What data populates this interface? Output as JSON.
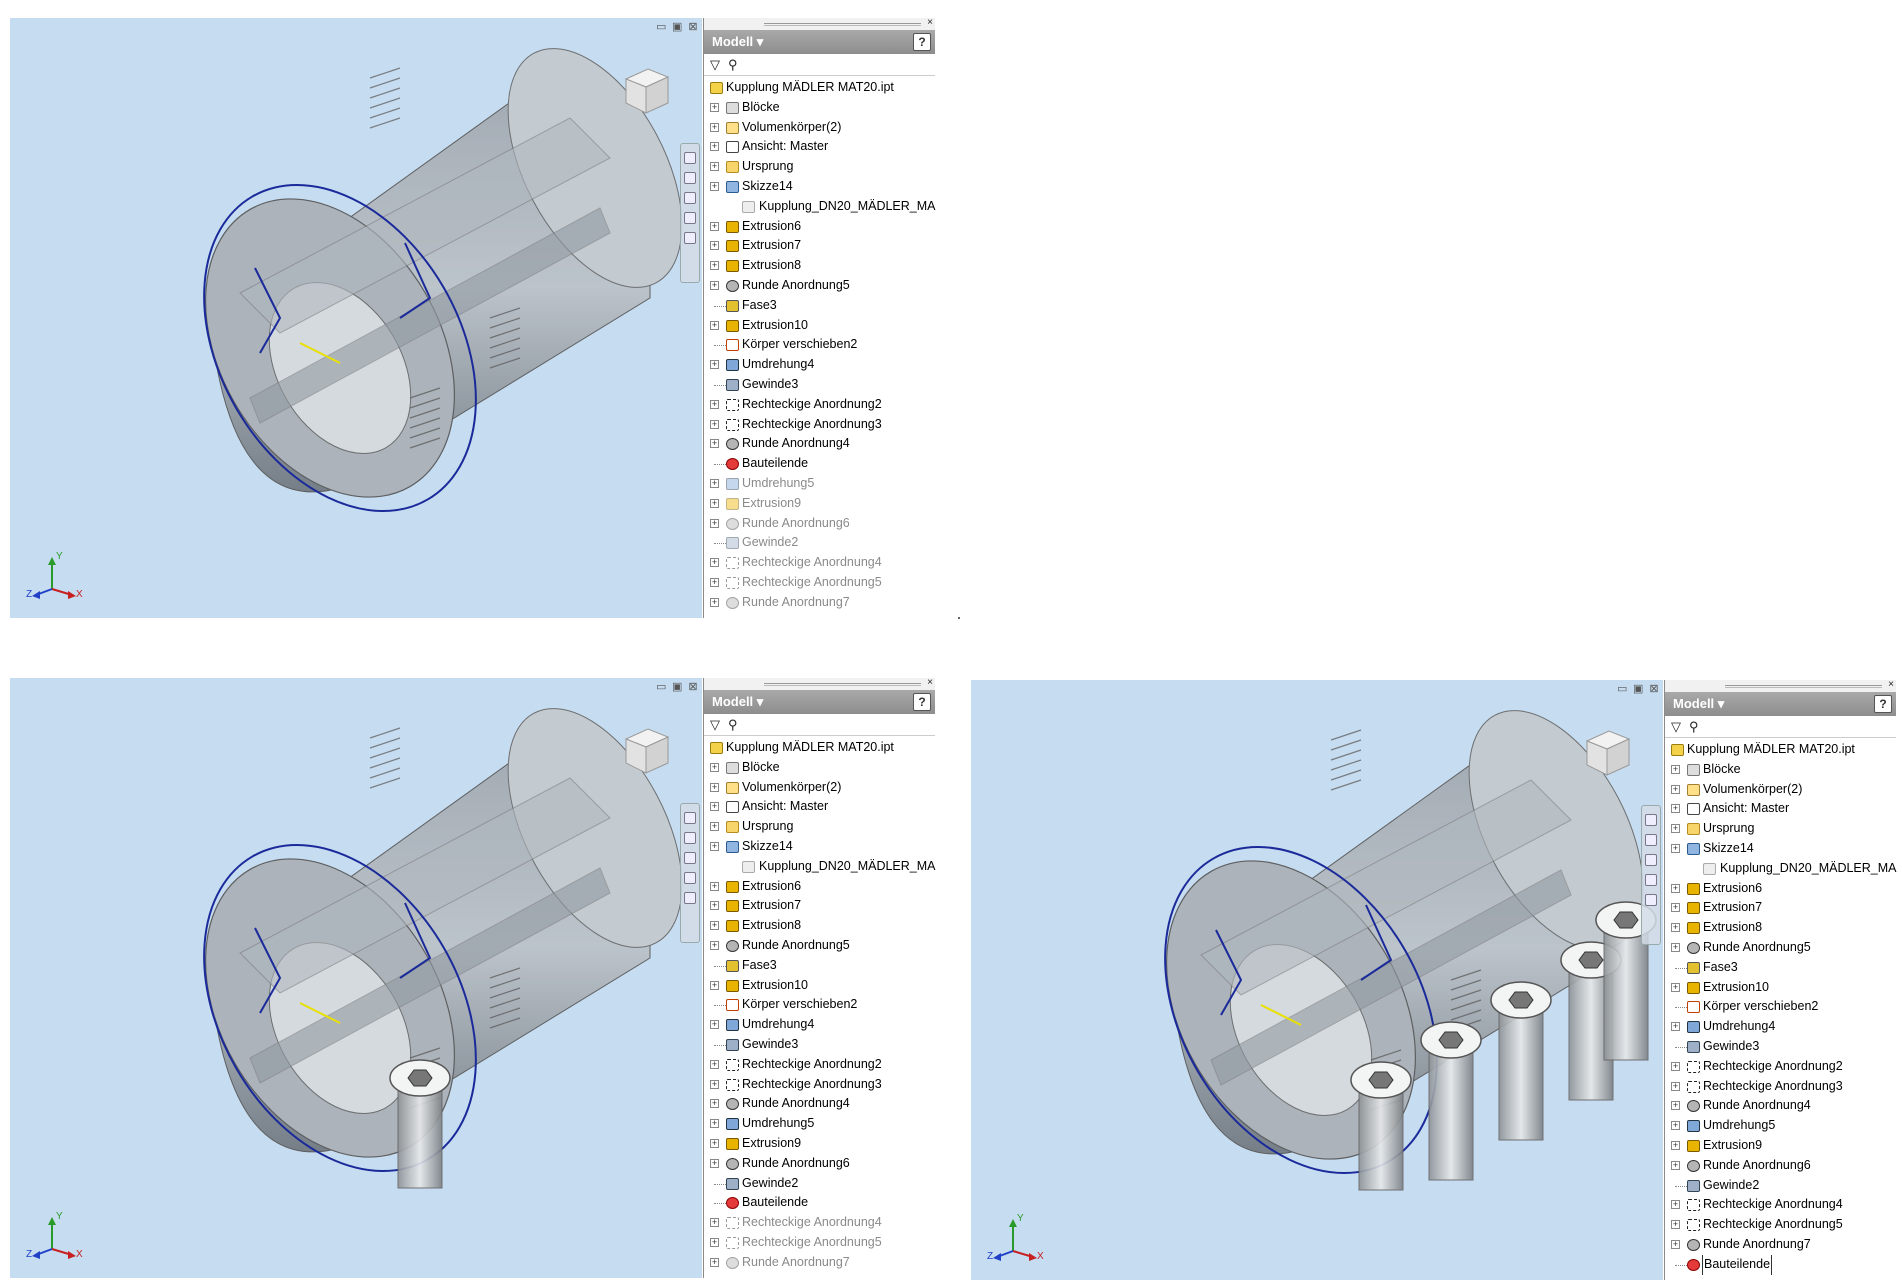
{
  "window_controls": {
    "minimize": "▭",
    "restore": "▣",
    "close": "⊠"
  },
  "browser_labels": {
    "title": "Modell ▾",
    "help": "?",
    "filter_icon": "filter-icon",
    "search_icon": "binoculars-icon",
    "close": "×"
  },
  "triad_labels": {
    "x": "X",
    "y": "Y",
    "z": "Z"
  },
  "panels": [
    {
      "id": "top-left",
      "screws": 0,
      "tree": [
        {
          "label": "Kupplung MÄDLER MAT20.ipt",
          "icon": "part-icon",
          "level": 0
        },
        {
          "label": "Blöcke",
          "icon": "block-icon",
          "level": 1,
          "expander": true
        },
        {
          "label": "Volumenkörper(2)",
          "icon": "solid-bodies-icon",
          "level": 1,
          "expander": true
        },
        {
          "label": "Ansicht: Master",
          "icon": "view-icon",
          "level": 1,
          "expander": true
        },
        {
          "label": "Ursprung",
          "icon": "folder-icon",
          "level": 1,
          "expander": true
        },
        {
          "label": "Skizze14",
          "icon": "sketch-icon",
          "level": 1,
          "expander": true
        },
        {
          "label": "Kupplung_DN20_MÄDLER_MA",
          "icon": "sketch-ref-icon",
          "level": 2
        },
        {
          "label": "Extrusion6",
          "icon": "extrusion-icon",
          "level": 1,
          "expander": true
        },
        {
          "label": "Extrusion7",
          "icon": "extrusion-icon",
          "level": 1,
          "expander": true
        },
        {
          "label": "Extrusion8",
          "icon": "extrusion-icon",
          "level": 1,
          "expander": true
        },
        {
          "label": "Runde Anordnung5",
          "icon": "circular-pattern-icon",
          "level": 1,
          "expander": true
        },
        {
          "label": "Fase3",
          "icon": "chamfer-icon",
          "level": 1
        },
        {
          "label": "Extrusion10",
          "icon": "extrusion-icon",
          "level": 1,
          "expander": true
        },
        {
          "label": "Körper verschieben2",
          "icon": "move-body-icon",
          "level": 1
        },
        {
          "label": "Umdrehung4",
          "icon": "revolve-icon",
          "level": 1,
          "expander": true
        },
        {
          "label": "Gewinde3",
          "icon": "thread-icon",
          "level": 1
        },
        {
          "label": "Rechteckige Anordnung2",
          "icon": "rect-pattern-icon",
          "level": 1,
          "expander": true
        },
        {
          "label": "Rechteckige Anordnung3",
          "icon": "rect-pattern-icon",
          "level": 1,
          "expander": true
        },
        {
          "label": "Runde Anordnung4",
          "icon": "circular-pattern-icon",
          "level": 1,
          "expander": true
        },
        {
          "label": "Bauteilende",
          "icon": "end-of-part-icon",
          "level": 1
        },
        {
          "label": "Umdrehung5",
          "icon": "revolve-icon",
          "level": 1,
          "expander": true,
          "dim": true
        },
        {
          "label": "Extrusion9",
          "icon": "extrusion-icon",
          "level": 1,
          "expander": true,
          "dim": true
        },
        {
          "label": "Runde Anordnung6",
          "icon": "circular-pattern-icon",
          "level": 1,
          "expander": true,
          "dim": true
        },
        {
          "label": "Gewinde2",
          "icon": "thread-icon",
          "level": 1,
          "dim": true
        },
        {
          "label": "Rechteckige Anordnung4",
          "icon": "rect-pattern-icon",
          "level": 1,
          "expander": true,
          "dim": true
        },
        {
          "label": "Rechteckige Anordnung5",
          "icon": "rect-pattern-icon",
          "level": 1,
          "expander": true,
          "dim": true
        },
        {
          "label": "Runde Anordnung7",
          "icon": "circular-pattern-icon",
          "level": 1,
          "expander": true,
          "dim": true
        }
      ]
    },
    {
      "id": "bottom-left",
      "screws": 1,
      "tree": [
        {
          "label": "Kupplung MÄDLER MAT20.ipt",
          "icon": "part-icon",
          "level": 0
        },
        {
          "label": "Blöcke",
          "icon": "block-icon",
          "level": 1,
          "expander": true
        },
        {
          "label": "Volumenkörper(2)",
          "icon": "solid-bodies-icon",
          "level": 1,
          "expander": true
        },
        {
          "label": "Ansicht: Master",
          "icon": "view-icon",
          "level": 1,
          "expander": true
        },
        {
          "label": "Ursprung",
          "icon": "folder-icon",
          "level": 1,
          "expander": true
        },
        {
          "label": "Skizze14",
          "icon": "sketch-icon",
          "level": 1,
          "expander": true
        },
        {
          "label": "Kupplung_DN20_MÄDLER_MA",
          "icon": "sketch-ref-icon",
          "level": 2
        },
        {
          "label": "Extrusion6",
          "icon": "extrusion-icon",
          "level": 1,
          "expander": true
        },
        {
          "label": "Extrusion7",
          "icon": "extrusion-icon",
          "level": 1,
          "expander": true
        },
        {
          "label": "Extrusion8",
          "icon": "extrusion-icon",
          "level": 1,
          "expander": true
        },
        {
          "label": "Runde Anordnung5",
          "icon": "circular-pattern-icon",
          "level": 1,
          "expander": true
        },
        {
          "label": "Fase3",
          "icon": "chamfer-icon",
          "level": 1
        },
        {
          "label": "Extrusion10",
          "icon": "extrusion-icon",
          "level": 1,
          "expander": true
        },
        {
          "label": "Körper verschieben2",
          "icon": "move-body-icon",
          "level": 1
        },
        {
          "label": "Umdrehung4",
          "icon": "revolve-icon",
          "level": 1,
          "expander": true
        },
        {
          "label": "Gewinde3",
          "icon": "thread-icon",
          "level": 1
        },
        {
          "label": "Rechteckige Anordnung2",
          "icon": "rect-pattern-icon",
          "level": 1,
          "expander": true
        },
        {
          "label": "Rechteckige Anordnung3",
          "icon": "rect-pattern-icon",
          "level": 1,
          "expander": true
        },
        {
          "label": "Runde Anordnung4",
          "icon": "circular-pattern-icon",
          "level": 1,
          "expander": true
        },
        {
          "label": "Umdrehung5",
          "icon": "revolve-icon",
          "level": 1,
          "expander": true
        },
        {
          "label": "Extrusion9",
          "icon": "extrusion-icon",
          "level": 1,
          "expander": true
        },
        {
          "label": "Runde Anordnung6",
          "icon": "circular-pattern-icon",
          "level": 1,
          "expander": true
        },
        {
          "label": "Gewinde2",
          "icon": "thread-icon",
          "level": 1
        },
        {
          "label": "Bauteilende",
          "icon": "end-of-part-icon",
          "level": 1
        },
        {
          "label": "Rechteckige Anordnung4",
          "icon": "rect-pattern-icon",
          "level": 1,
          "expander": true,
          "dim": true
        },
        {
          "label": "Rechteckige Anordnung5",
          "icon": "rect-pattern-icon",
          "level": 1,
          "expander": true,
          "dim": true
        },
        {
          "label": "Runde Anordnung7",
          "icon": "circular-pattern-icon",
          "level": 1,
          "expander": true,
          "dim": true
        }
      ]
    },
    {
      "id": "bottom-right",
      "screws": 5,
      "tree": [
        {
          "label": "Kupplung MÄDLER MAT20.ipt",
          "icon": "part-icon",
          "level": 0
        },
        {
          "label": "Blöcke",
          "icon": "block-icon",
          "level": 1,
          "expander": true
        },
        {
          "label": "Volumenkörper(2)",
          "icon": "solid-bodies-icon",
          "level": 1,
          "expander": true
        },
        {
          "label": "Ansicht: Master",
          "icon": "view-icon",
          "level": 1,
          "expander": true
        },
        {
          "label": "Ursprung",
          "icon": "folder-icon",
          "level": 1,
          "expander": true
        },
        {
          "label": "Skizze14",
          "icon": "sketch-icon",
          "level": 1,
          "expander": true
        },
        {
          "label": "Kupplung_DN20_MÄDLER_MA",
          "icon": "sketch-ref-icon",
          "level": 2
        },
        {
          "label": "Extrusion6",
          "icon": "extrusion-icon",
          "level": 1,
          "expander": true
        },
        {
          "label": "Extrusion7",
          "icon": "extrusion-icon",
          "level": 1,
          "expander": true
        },
        {
          "label": "Extrusion8",
          "icon": "extrusion-icon",
          "level": 1,
          "expander": true
        },
        {
          "label": "Runde Anordnung5",
          "icon": "circular-pattern-icon",
          "level": 1,
          "expander": true
        },
        {
          "label": "Fase3",
          "icon": "chamfer-icon",
          "level": 1
        },
        {
          "label": "Extrusion10",
          "icon": "extrusion-icon",
          "level": 1,
          "expander": true
        },
        {
          "label": "Körper verschieben2",
          "icon": "move-body-icon",
          "level": 1
        },
        {
          "label": "Umdrehung4",
          "icon": "revolve-icon",
          "level": 1,
          "expander": true
        },
        {
          "label": "Gewinde3",
          "icon": "thread-icon",
          "level": 1
        },
        {
          "label": "Rechteckige Anordnung2",
          "icon": "rect-pattern-icon",
          "level": 1,
          "expander": true
        },
        {
          "label": "Rechteckige Anordnung3",
          "icon": "rect-pattern-icon",
          "level": 1,
          "expander": true
        },
        {
          "label": "Runde Anordnung4",
          "icon": "circular-pattern-icon",
          "level": 1,
          "expander": true
        },
        {
          "label": "Umdrehung5",
          "icon": "revolve-icon",
          "level": 1,
          "expander": true
        },
        {
          "label": "Extrusion9",
          "icon": "extrusion-icon",
          "level": 1,
          "expander": true
        },
        {
          "label": "Runde Anordnung6",
          "icon": "circular-pattern-icon",
          "level": 1,
          "expander": true
        },
        {
          "label": "Gewinde2",
          "icon": "thread-icon",
          "level": 1
        },
        {
          "label": "Rechteckige Anordnung4",
          "icon": "rect-pattern-icon",
          "level": 1,
          "expander": true
        },
        {
          "label": "Rechteckige Anordnung5",
          "icon": "rect-pattern-icon",
          "level": 1,
          "expander": true
        },
        {
          "label": "Runde Anordnung7",
          "icon": "circular-pattern-icon",
          "level": 1,
          "expander": true
        },
        {
          "label": "Bauteilende",
          "icon": "end-of-part-icon",
          "level": 1,
          "selected": true
        }
      ]
    }
  ]
}
